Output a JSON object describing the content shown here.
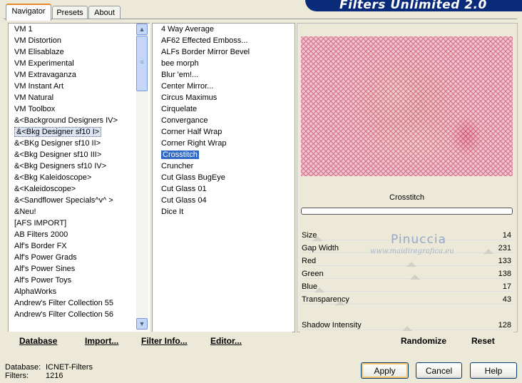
{
  "tabs": [
    {
      "label": "Navigator"
    },
    {
      "label": "Presets"
    },
    {
      "label": "About"
    }
  ],
  "banner_title": "Filters Unlimited 2.0",
  "categories": [
    "VM 1",
    "VM Distortion",
    "VM Elisablaze",
    "VM Experimental",
    "VM Extravaganza",
    "VM Instant Art",
    "VM Natural",
    "VM Toolbox",
    "&<Background Designers IV>",
    "&<Bkg Designer sf10 I>",
    "&<BKg Designer sf10 II>",
    "&<Bkg Designer sf10 III>",
    "&<Bkg Designers sf10 IV>",
    "&<Bkg Kaleidoscope>",
    "&<Kaleidoscope>",
    "&<Sandflower Specials^v^ >",
    "&Neu!",
    "[AFS IMPORT]",
    "AB Filters 2000",
    "Alf's Border FX",
    "Alf's Power Grads",
    "Alf's Power Sines",
    "Alf's Power Toys",
    "AlphaWorks",
    "Andrew's Filter Collection 55",
    "Andrew's Filter Collection 56"
  ],
  "selected_category_index": 9,
  "filters": [
    "4 Way Average",
    "AF62 Effected Emboss...",
    "ALFs Border Mirror Bevel",
    "bee morph",
    "Blur 'em!...",
    "Center Mirror...",
    "Circus Maximus",
    "Cirquelate",
    "Convergance",
    "Corner Half Wrap",
    "Corner Right Wrap",
    "Crosstitch",
    "Cruncher",
    "Cut Glass  BugEye",
    "Cut Glass 01",
    "Cut Glass 04",
    "Dice It"
  ],
  "selected_filter_index": 11,
  "left_buttons": {
    "database": "Database",
    "import": "Import...",
    "filter_info": "Filter Info...",
    "editor": "Editor..."
  },
  "selected_filter_name": "Crosstitch",
  "watermark": {
    "line1": "Pinuccia",
    "line2": "www.maidiregrafica.eu"
  },
  "params": [
    {
      "label": "Size",
      "value": "14",
      "level": 0.055
    },
    {
      "label": "Gap Width",
      "value": "231",
      "level": 0.906
    },
    {
      "label": "Red",
      "value": "133",
      "level": 0.522
    },
    {
      "label": "Green",
      "value": "138",
      "level": 0.541
    },
    {
      "label": "Blue",
      "value": "17",
      "level": 0.067
    },
    {
      "label": "Transparency",
      "value": "43",
      "level": 0.169
    },
    {
      "label": "Shadow Intensity",
      "value": "128",
      "level": 0.502
    }
  ],
  "right_buttons": {
    "randomize": "Randomize",
    "reset": "Reset"
  },
  "footer": {
    "database_label": "Database:",
    "database_value": "ICNET-Filters",
    "filters_label": "Filters:",
    "filters_value": "1216"
  },
  "dialog_buttons": {
    "apply": "Apply",
    "cancel": "Cancel",
    "help": "Help"
  },
  "colors": {
    "accent_selection": "#316ac5",
    "banner": "#0a2b7a",
    "preview_base": "#f8d6df"
  }
}
